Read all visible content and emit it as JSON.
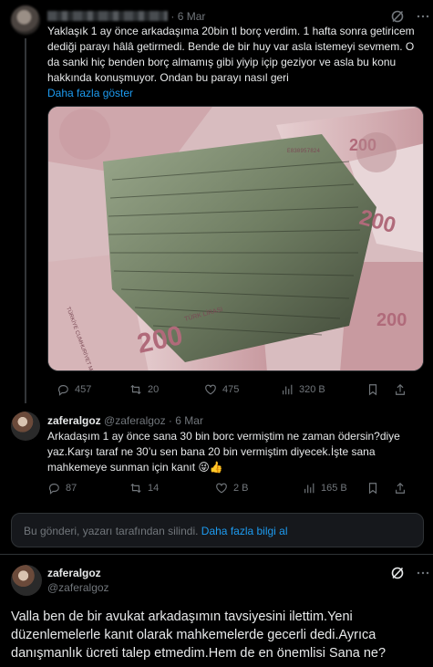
{
  "tweet1": {
    "date": "6 Mar",
    "text": "Yaklaşık 1 ay önce arkadaşıma 20bin tl borç verdim. 1 hafta sonra getiricem dediği parayı hâlâ getirmedi. Bende de bir huy var asla istemeyi sevmem. O da sanki hiç benden borç almamış gibi yiyip içip geziyor ve asla bu konu hakkında konuşmuyor. Ondan bu parayı nasıl geri",
    "show_more": "Daha fazla göster",
    "replies": "457",
    "retweets": "20",
    "likes": "475",
    "views": "320 B"
  },
  "tweet2": {
    "name": "zaferalgoz",
    "handle": "@zaferalgoz",
    "date": "6 Mar",
    "text_line1": "Arkadaşım 1 ay önce sana 30 bin borc vermiştim ne zaman ödersin?diye",
    "text_line2": "yaz.Karşı taraf ne 30’u sen bana 20 bin vermiştim diyecek.İşte sana",
    "text_line3": "mahkemeye sunman için kanıt",
    "emoji": "😜👍",
    "replies": "87",
    "retweets": "14",
    "likes": "2 B",
    "views": "165 B"
  },
  "deleted_notice": {
    "text": "Bu gönderi, yazarı tarafından silindi.",
    "link": "Daha fazla bilgi al"
  },
  "tweet3": {
    "name": "zaferalgoz",
    "handle": "@zaferalgoz",
    "text": "Valla ben de bir avukat arkadaşımın tavsiyesini ilettim.Yeni düzenlemelerle kanıt olarak mahkemelerde gecerli dedi.Ayrıca danışmanlık ücreti talep etmedim.Hem de en önemlisi Sana ne?"
  },
  "banknote_labels": {
    "bank": "TÜRKİYE CUMHURİYET MERKEZ",
    "denomination": "200",
    "currency": "TÜRK LİRASI",
    "serial": "E830957824"
  },
  "icons": [
    "grok-icon",
    "more-icon",
    "reply-icon",
    "retweet-icon",
    "like-icon",
    "views-icon",
    "bookmark-icon",
    "share-icon"
  ]
}
